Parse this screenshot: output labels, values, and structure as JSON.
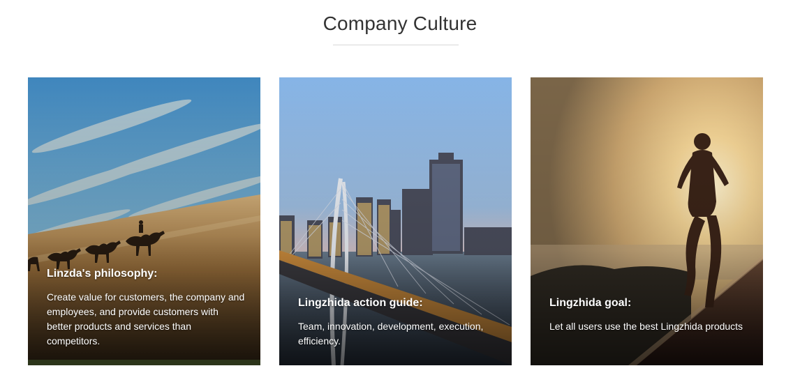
{
  "section": {
    "title": "Company Culture"
  },
  "cards": [
    {
      "heading": "Linzda's philosophy:",
      "body": "Create value for customers, the company and employees, and provide customers with better products and services than competitors.",
      "image": "desert-camel-caravan-photo"
    },
    {
      "heading": "Lingzhida action guide:",
      "body": "Team, innovation, development, execution, efficiency.",
      "image": "city-bridge-skyline-photo"
    },
    {
      "heading": "Lingzhida goal:",
      "body": "Let all users use the best Lingzhida products",
      "image": "runner-sunset-photo"
    }
  ],
  "colors": {
    "title": "#333333",
    "underline": "#d7d7d7",
    "card_text": "#ffffff"
  }
}
